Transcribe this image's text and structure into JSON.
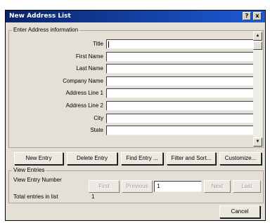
{
  "window": {
    "title": "New Address List",
    "help_glyph": "?",
    "close_glyph": "x"
  },
  "address_group": {
    "legend": "Enter Address information",
    "fields": [
      {
        "label": "Title",
        "value": ""
      },
      {
        "label": "First Name",
        "value": ""
      },
      {
        "label": "Last Name",
        "value": ""
      },
      {
        "label": "Company Name",
        "value": ""
      },
      {
        "label": "Address Line 1",
        "value": ""
      },
      {
        "label": "Address Line 2",
        "value": ""
      },
      {
        "label": "City",
        "value": ""
      },
      {
        "label": "State",
        "value": ""
      }
    ]
  },
  "actions": {
    "new_entry": "New Entry",
    "delete_entry": "Delete Entry",
    "find_entry": "Find Entry ...",
    "filter_sort": "Filter and Sort...",
    "customize": "Customize..."
  },
  "view_group": {
    "legend": "View Entries",
    "entry_number_label": "View Entry Number",
    "first": "First",
    "previous": "Previous",
    "entry_number_value": "1",
    "next": "Next",
    "last": "Last",
    "total_label": "Total entries in list",
    "total_value": "1"
  },
  "footer": {
    "cancel": "Cancel"
  },
  "icons": {
    "scroll_up": "scroll-up-arrow-icon",
    "scroll_down": "scroll-down-arrow-icon"
  },
  "colors": {
    "titlebar_start": "#0a246a",
    "titlebar_end": "#1c5bd6",
    "dialog_face": "#e4e0d6"
  }
}
